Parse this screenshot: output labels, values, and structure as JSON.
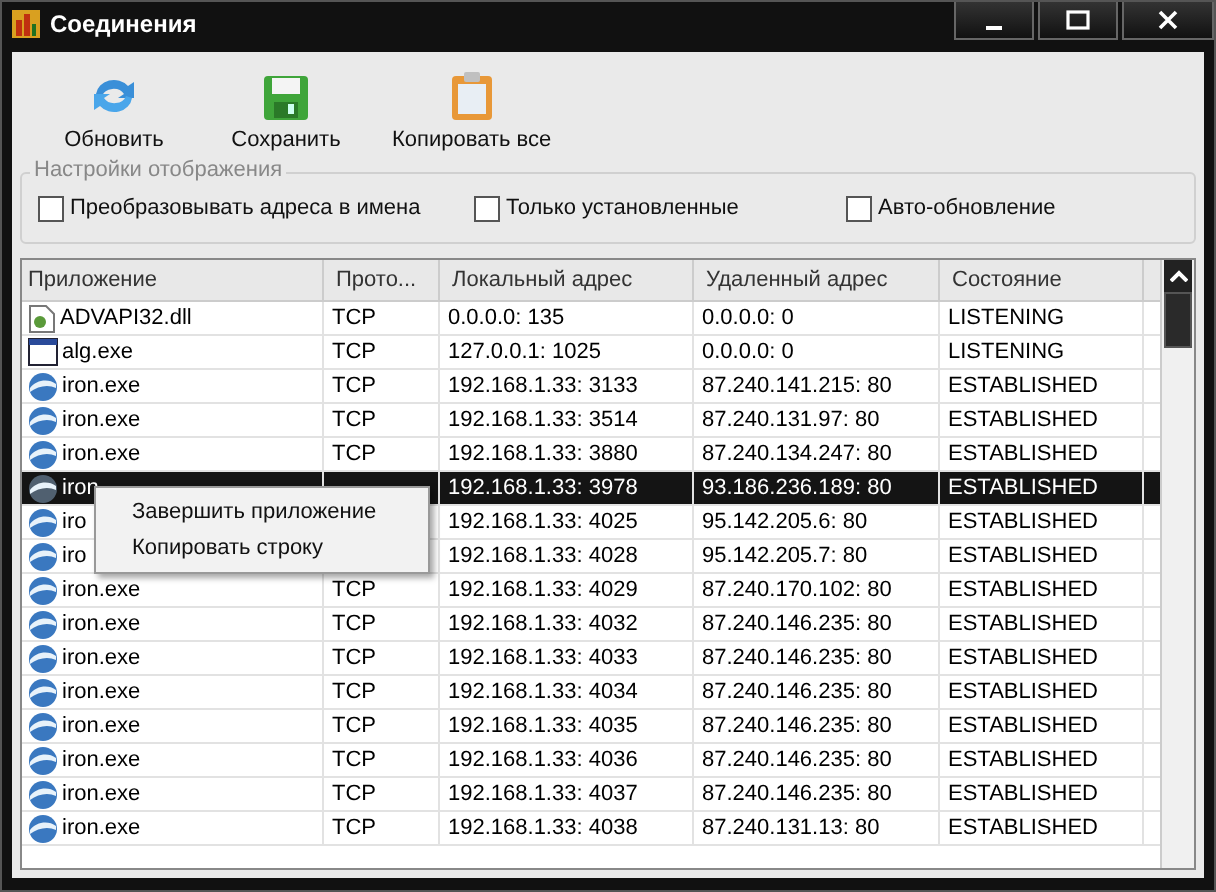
{
  "window": {
    "title": "Соединения"
  },
  "toolbar": [
    {
      "label": "Обновить",
      "kind": "refresh"
    },
    {
      "label": "Сохранить",
      "kind": "save"
    },
    {
      "label": "Копировать все",
      "kind": "copy"
    }
  ],
  "display_settings": {
    "title": "Настройки отображения",
    "options": [
      {
        "label": "Преобразовывать адреса в имена",
        "checked": false
      },
      {
        "label": "Только установленные",
        "checked": false
      },
      {
        "label": "Авто-обновление",
        "checked": false
      }
    ]
  },
  "table": {
    "columns": [
      "Приложение",
      "Прото...",
      "Локальный адрес",
      "Удаленный адрес",
      "Состояние"
    ],
    "rows": [
      {
        "app": "ADVAPI32.dll",
        "proto": "TCP",
        "local": "0.0.0.0: 135",
        "remote": "0.0.0.0: 0",
        "state": "LISTENING",
        "selected": false
      },
      {
        "app": "alg.exe",
        "proto": "TCP",
        "local": "127.0.0.1: 1025",
        "remote": "0.0.0.0: 0",
        "state": "LISTENING",
        "selected": false
      },
      {
        "app": "iron.exe",
        "proto": "TCP",
        "local": "192.168.1.33: 3133",
        "remote": "87.240.141.215: 80",
        "state": "ESTABLISHED",
        "selected": false
      },
      {
        "app": "iron.exe",
        "proto": "TCP",
        "local": "192.168.1.33: 3514",
        "remote": "87.240.131.97: 80",
        "state": "ESTABLISHED",
        "selected": false
      },
      {
        "app": "iron.exe",
        "proto": "TCP",
        "local": "192.168.1.33: 3880",
        "remote": "87.240.134.247: 80",
        "state": "ESTABLISHED",
        "selected": false
      },
      {
        "app": "iron",
        "local": "192.168.1.33: 3978",
        "remote": "93.186.236.189: 80",
        "state": "ESTABLISHED",
        "selected": true
      },
      {
        "app": "iro",
        "local": "192.168.1.33: 4025",
        "remote": "95.142.205.6: 80",
        "state": "ESTABLISHED",
        "selected": false
      },
      {
        "app": "iro",
        "local": "192.168.1.33: 4028",
        "remote": "95.142.205.7: 80",
        "state": "ESTABLISHED",
        "selected": false
      },
      {
        "app": "iron.exe",
        "proto": "TCP",
        "local": "192.168.1.33: 4029",
        "remote": "87.240.170.102: 80",
        "state": "ESTABLISHED",
        "selected": false
      },
      {
        "app": "iron.exe",
        "proto": "TCP",
        "local": "192.168.1.33: 4032",
        "remote": "87.240.146.235: 80",
        "state": "ESTABLISHED",
        "selected": false
      },
      {
        "app": "iron.exe",
        "proto": "TCP",
        "local": "192.168.1.33: 4033",
        "remote": "87.240.146.235: 80",
        "state": "ESTABLISHED",
        "selected": false
      },
      {
        "app": "iron.exe",
        "proto": "TCP",
        "local": "192.168.1.33: 4034",
        "remote": "87.240.146.235: 80",
        "state": "ESTABLISHED",
        "selected": false
      },
      {
        "app": "iron.exe",
        "proto": "TCP",
        "local": "192.168.1.33: 4035",
        "remote": "87.240.146.235: 80",
        "state": "ESTABLISHED",
        "selected": false
      },
      {
        "app": "iron.exe",
        "proto": "TCP",
        "local": "192.168.1.33: 4036",
        "remote": "87.240.146.235: 80",
        "state": "ESTABLISHED",
        "selected": false
      },
      {
        "app": "iron.exe",
        "proto": "TCP",
        "local": "192.168.1.33: 4037",
        "remote": "87.240.146.235: 80",
        "state": "ESTABLISHED",
        "selected": false
      },
      {
        "app": "iron.exe",
        "proto": "TCP",
        "local": "192.168.1.33: 4038",
        "remote": "87.240.131.13: 80",
        "state": "ESTABLISHED",
        "selected": false
      }
    ]
  },
  "context_menu": [
    "Завершить приложение",
    "Копировать строку"
  ]
}
